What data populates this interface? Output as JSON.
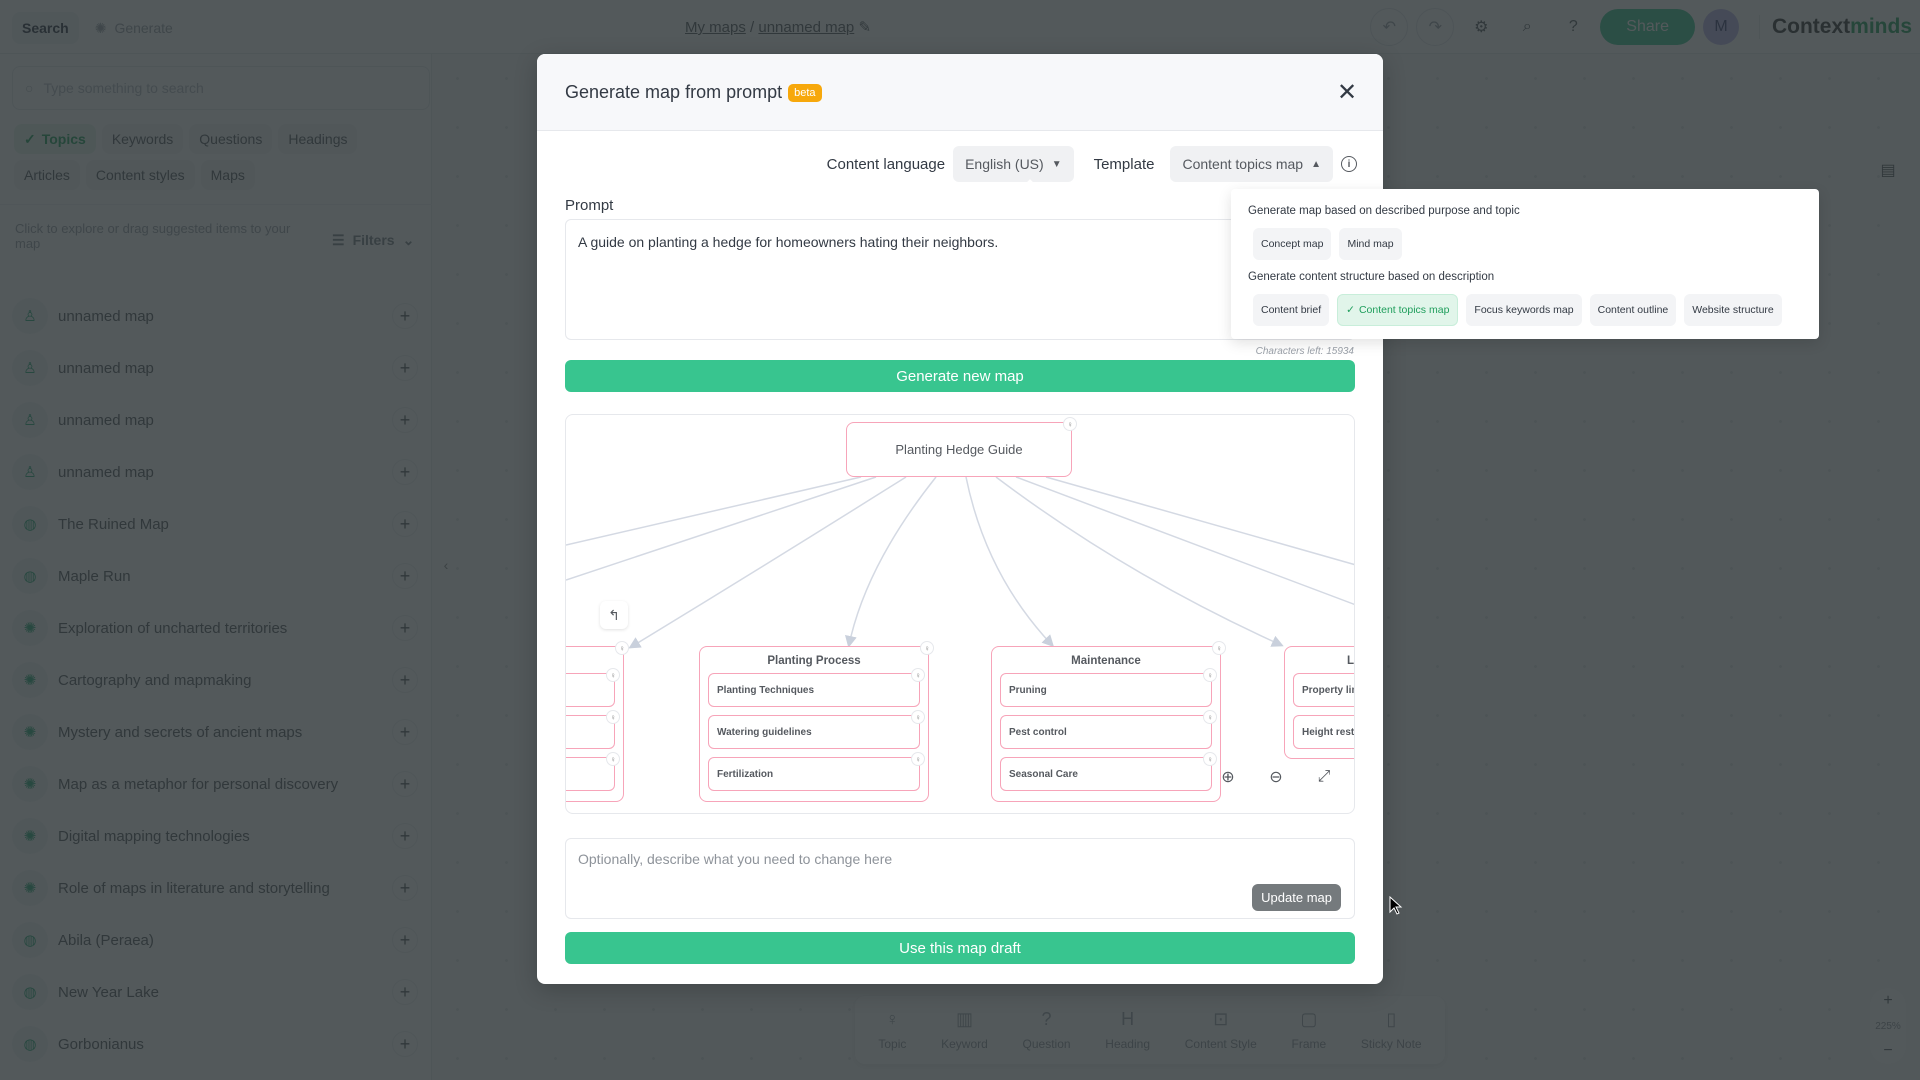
{
  "app": {
    "logo_part1": "Context",
    "logo_part2": "minds",
    "breadcrumb": {
      "root": "My maps",
      "separator": "/",
      "current": "unnamed map"
    },
    "left_tabs": [
      "Search",
      "Generate"
    ],
    "share_label": "Share",
    "avatar_initial": "M",
    "brand_color": "#38c58f"
  },
  "sidebar": {
    "search_placeholder": "Type something to search",
    "chips": [
      {
        "label": "Topics",
        "active": true
      },
      {
        "label": "Keywords"
      },
      {
        "label": "Questions"
      },
      {
        "label": "Headings"
      },
      {
        "label": "Articles"
      },
      {
        "label": "Content styles"
      },
      {
        "label": "Maps"
      }
    ],
    "hint": "Click to explore or drag suggested items to your map",
    "filters_label": "Filters",
    "items": [
      {
        "icon": "user-icon",
        "label": "unnamed map"
      },
      {
        "icon": "user-icon",
        "label": "unnamed map"
      },
      {
        "icon": "user-icon",
        "label": "unnamed map"
      },
      {
        "icon": "user-icon",
        "label": "unnamed map"
      },
      {
        "icon": "globe-icon",
        "label": "The Ruined Map"
      },
      {
        "icon": "globe-icon",
        "label": "Maple Run"
      },
      {
        "icon": "ai-icon",
        "label": "Exploration of uncharted territories"
      },
      {
        "icon": "ai-icon",
        "label": "Cartography and mapmaking"
      },
      {
        "icon": "ai-icon",
        "label": "Mystery and secrets of ancient maps"
      },
      {
        "icon": "ai-icon",
        "label": "Map as a metaphor for personal discovery"
      },
      {
        "icon": "ai-icon",
        "label": "Digital mapping technologies"
      },
      {
        "icon": "ai-icon",
        "label": "Role of maps in literature and storytelling"
      },
      {
        "icon": "globe-icon",
        "label": "Abila (Peraea)"
      },
      {
        "icon": "globe-icon",
        "label": "New Year Lake"
      },
      {
        "icon": "globe-icon",
        "label": "Gorbonianus"
      }
    ]
  },
  "bottom_toolbar": {
    "tools": [
      "Topic",
      "Keyword",
      "Question",
      "Heading",
      "Content Style",
      "Frame",
      "Sticky Note"
    ],
    "zoom_level": "225%"
  },
  "modal": {
    "title": "Generate map from prompt",
    "badge": "beta",
    "content_language_label": "Content language",
    "content_language_value": "English (US)",
    "template_label": "Template",
    "template_value": "Content topics map",
    "prompt_label": "Prompt",
    "prompt_value": "A guide on planting a hedge for homeowners hating their neighbors.",
    "chars_left": "Characters left: 15934",
    "generate_button": "Generate new map",
    "change_placeholder": "Optionally, describe what you need to change here",
    "update_button": "Update map",
    "use_button": "Use this map draft",
    "map": {
      "root": "Planting Hedge Guide",
      "groups": [
        {
          "title": "",
          "children": [
            "",
            "",
            ""
          ]
        },
        {
          "title": "Planting Process",
          "children": [
            "Planting Techniques",
            "Watering guidelines",
            "Fertilization"
          ]
        },
        {
          "title": "Maintenance",
          "children": [
            "Pruning",
            "Pest control",
            "Seasonal Care"
          ]
        },
        {
          "title": "L",
          "children": [
            "Property lin",
            "Height restri"
          ]
        }
      ]
    }
  },
  "template_dropdown": {
    "section1_heading": "Generate map based on described purpose and topic",
    "section1_options": [
      "Concept map",
      "Mind map"
    ],
    "section2_heading": "Generate content structure based on description",
    "section2_options": [
      "Content brief",
      "Content topics map",
      "Focus keywords map",
      "Content outline",
      "Website structure"
    ],
    "selected": "Content topics map"
  }
}
